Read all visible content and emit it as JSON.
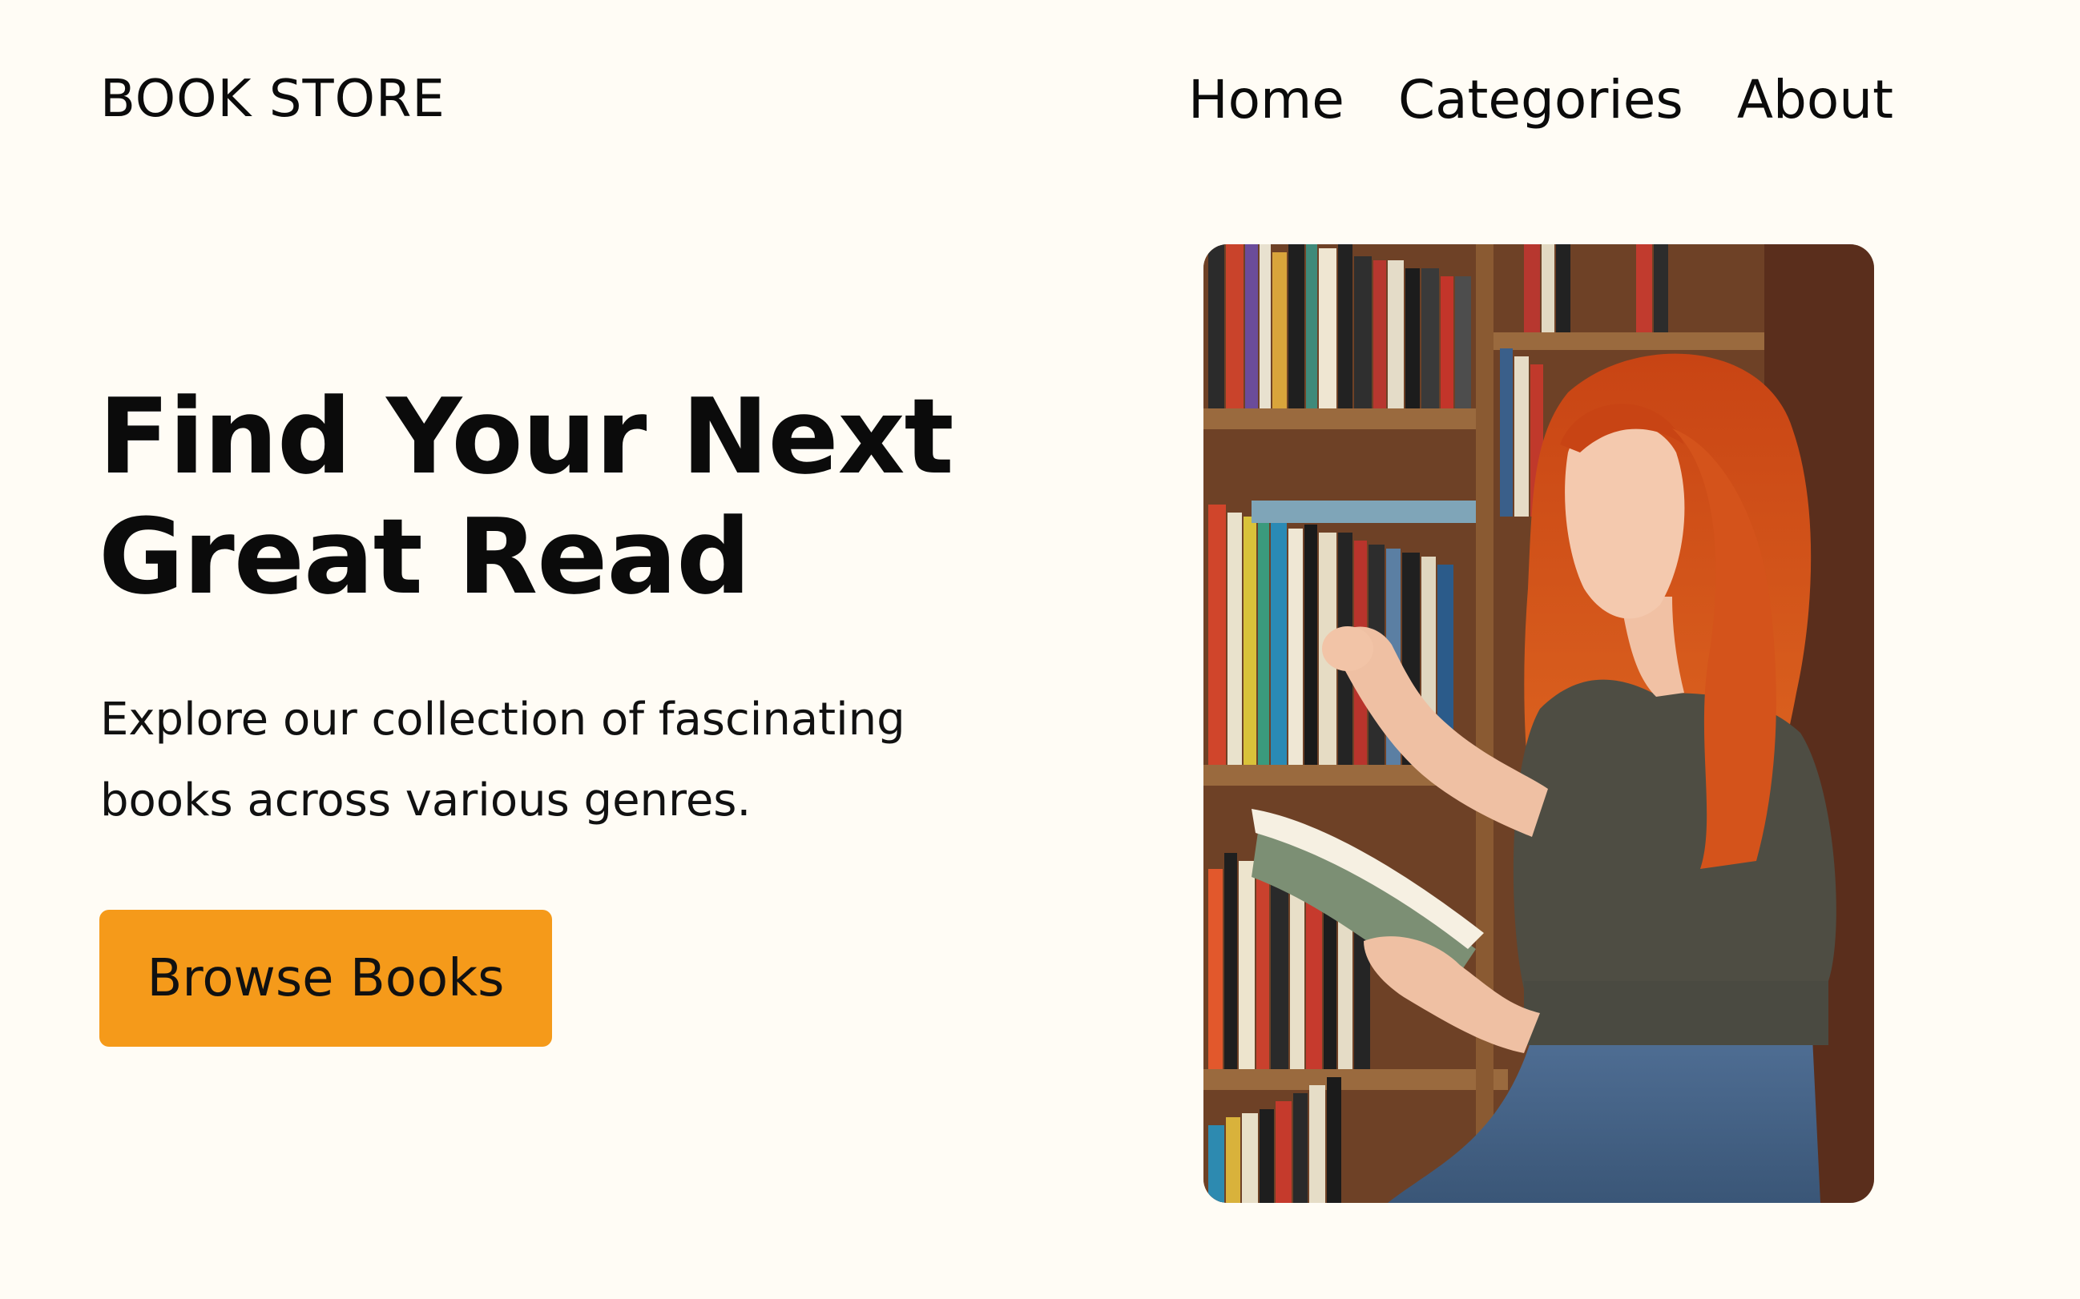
{
  "header": {
    "logo": "BOOK STORE",
    "nav": [
      "Home",
      "Categories",
      "About"
    ]
  },
  "hero": {
    "title_line1": "Find Your Next",
    "title_line2": "Great Read",
    "description": "Explore our collection of fascinating books across various genres.",
    "button_label": "Browse Books",
    "image_alt": "Woman with red hair browsing books on a bookshelf"
  },
  "colors": {
    "background": "#fffcf5",
    "accent": "#f59a1a",
    "text": "#0b0b0b"
  }
}
